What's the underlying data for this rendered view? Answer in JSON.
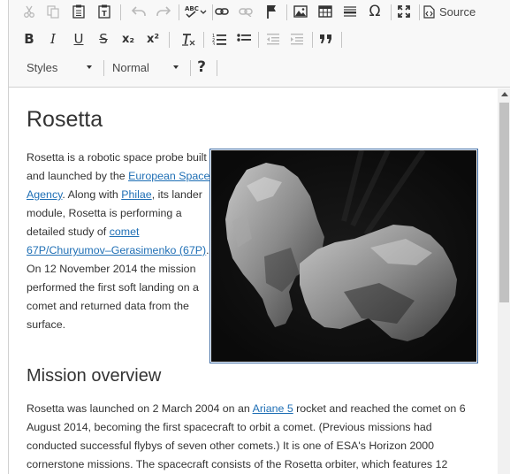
{
  "toolbar": {
    "source_label": "Source",
    "styles_label": "Styles",
    "format_label": "Normal",
    "help_label": "?",
    "bold_label": "B",
    "italic_label": "I",
    "underline_label": "U",
    "strike_label": "S",
    "subscript_label": "x₂",
    "superscript_label": "x²",
    "quote_label": "”",
    "omega_label": "Ω",
    "icons": [
      "cut-icon",
      "copy-icon",
      "paste-icon",
      "paste-text-icon",
      "undo-icon",
      "redo-icon",
      "spellcheck-icon",
      "link-icon",
      "unlink-icon",
      "anchor-icon",
      "image-icon",
      "table-icon",
      "horizontal-line-icon",
      "special-char-icon",
      "maximize-icon",
      "source-icon",
      "remove-format-icon",
      "numbered-list-icon",
      "bulleted-list-icon",
      "outdent-icon",
      "indent-icon",
      "blockquote-icon"
    ]
  },
  "document": {
    "title": "Rosetta",
    "intro_1": "Rosetta is a robotic space probe built and launched by the ",
    "link_esa": "European Space Agency",
    "intro_2": ". Along with ",
    "link_philae": "Philae",
    "intro_3": ", its lander module, Rosetta is performing a detailed study of ",
    "link_comet": "comet 67P/Churyumov–Gerasimenko (67P)",
    "intro_4": ". On 12 November 2014 the mission performed the first soft landing on a comet and returned data from the surface.",
    "section_heading": "Mission overview",
    "overview_1": "Rosetta was launched on 2 March 2004 on an ",
    "link_ariane": "Ariane 5",
    "overview_2": " rocket and reached the comet on 6 August 2014, becoming the first spacecraft to orbit a comet. (Previous missions had conducted successful flybys of seven other comets.) It is one of ESA's Horizon 2000 cornerstone missions. The spacecraft consists of the Rosetta orbiter, which features 12"
  }
}
